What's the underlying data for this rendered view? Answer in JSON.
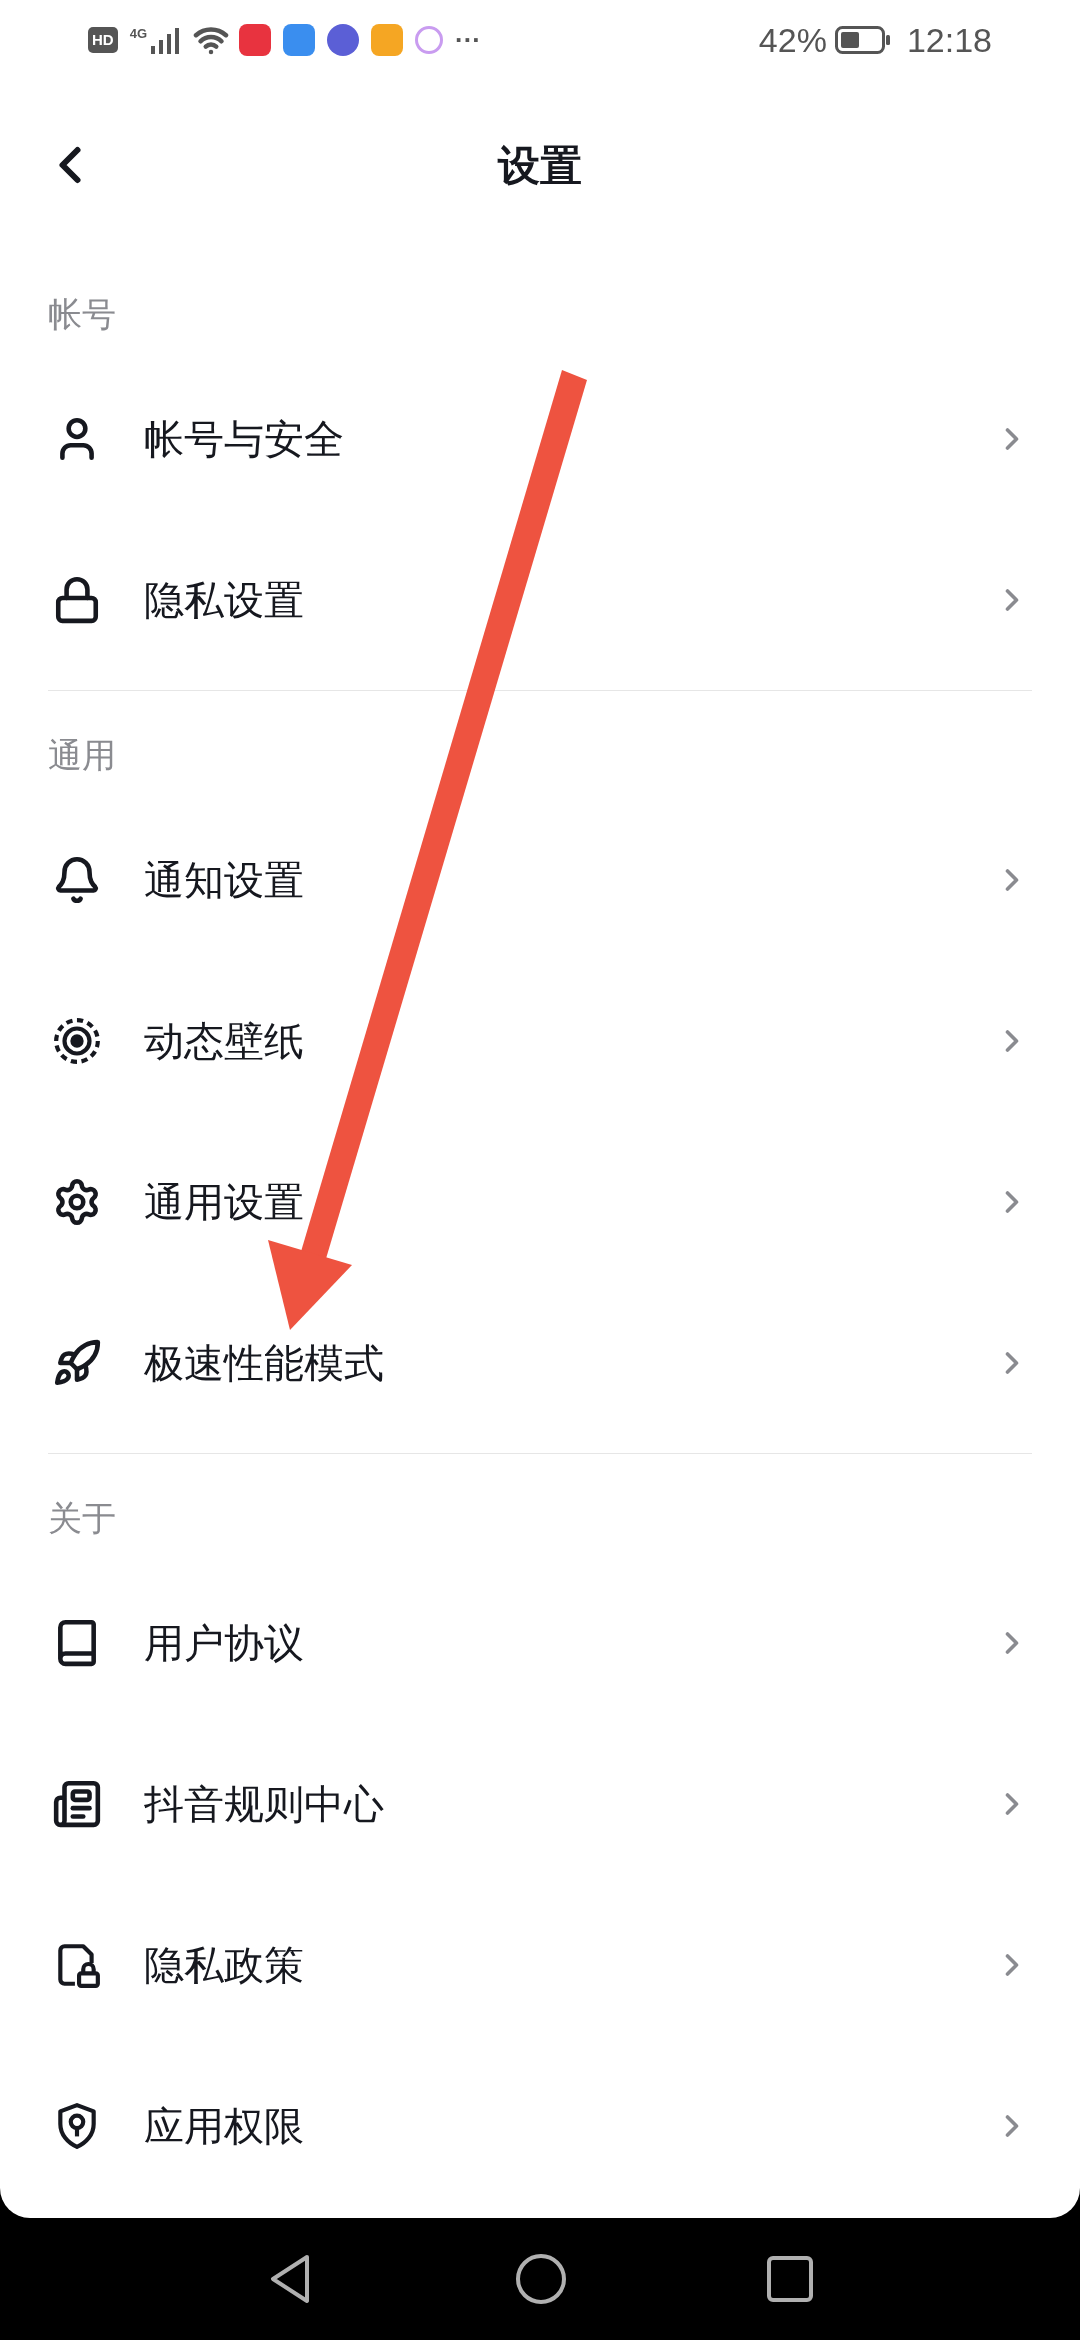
{
  "status_bar": {
    "hd": "HD",
    "network": "4G",
    "more": "···",
    "battery": "42%",
    "time": "12:18"
  },
  "header": {
    "title": "设置"
  },
  "sections": [
    {
      "title": "帐号",
      "items": [
        {
          "kind": "person",
          "label": "帐号与安全"
        },
        {
          "kind": "lock",
          "label": "隐私设置"
        }
      ]
    },
    {
      "title": "通用",
      "items": [
        {
          "kind": "bell",
          "label": "通知设置"
        },
        {
          "kind": "wallpaper",
          "label": "动态壁纸"
        },
        {
          "kind": "gear",
          "label": "通用设置"
        },
        {
          "kind": "rocket",
          "label": "极速性能模式"
        }
      ]
    },
    {
      "title": "关于",
      "items": [
        {
          "kind": "book",
          "label": "用户协议"
        },
        {
          "kind": "document",
          "label": "抖音规则中心"
        },
        {
          "kind": "doclock",
          "label": "隐私政策"
        },
        {
          "kind": "shield",
          "label": "应用权限"
        }
      ]
    }
  ]
}
